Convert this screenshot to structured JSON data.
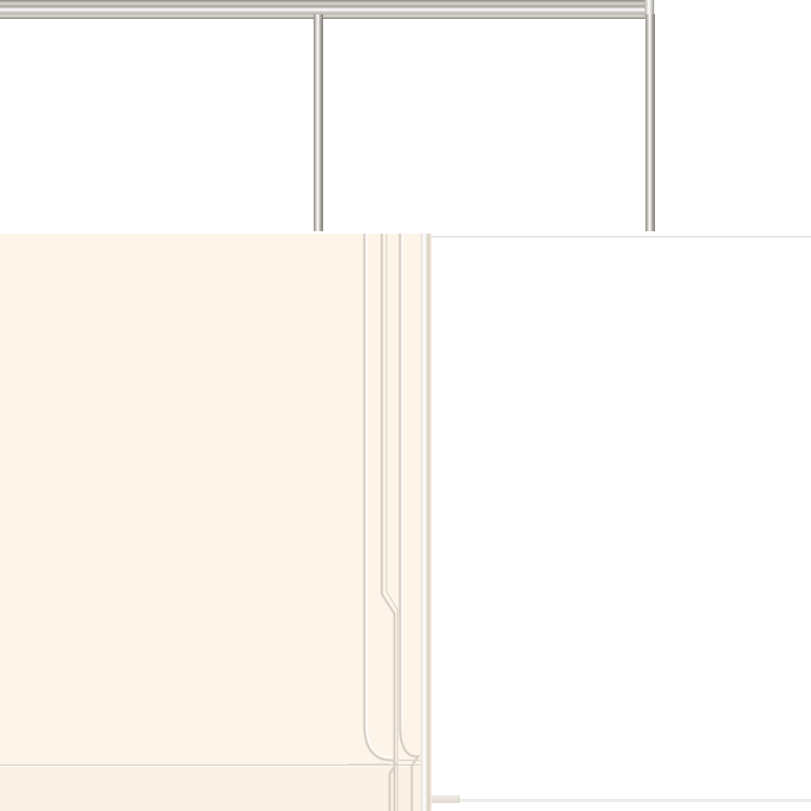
{
  "scene": {
    "description_free": true,
    "colors": {
      "frame_metal": "#b5b1aa",
      "cream_panel": "#fdf4ea",
      "groove_line": "#d9d1c6",
      "background": "#ffffff"
    }
  }
}
